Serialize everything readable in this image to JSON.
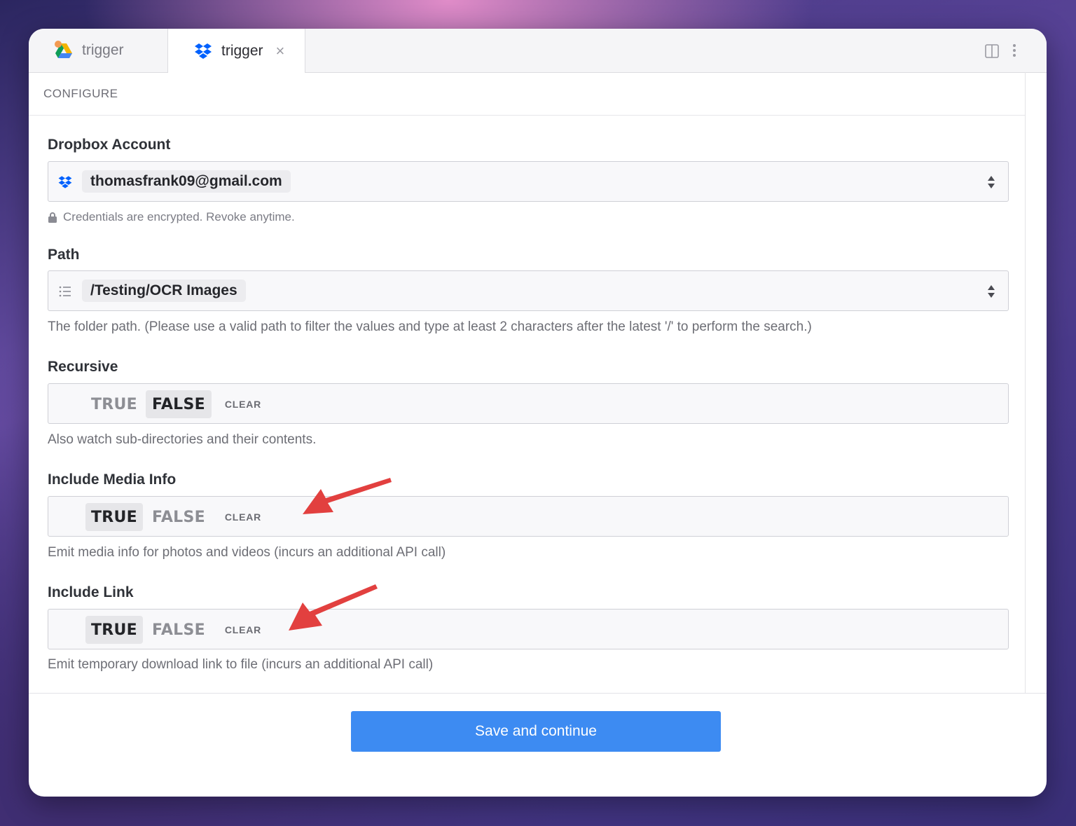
{
  "tabs": [
    {
      "label": "trigger",
      "icon": "google-drive-icon",
      "active": false
    },
    {
      "label": "trigger",
      "icon": "dropbox-icon",
      "active": true,
      "close_icon": "×"
    }
  ],
  "toolbar": {
    "split_icon": "split-view-icon",
    "more_icon": "more-vertical-icon"
  },
  "section": {
    "title": "CONFIGURE"
  },
  "fields": {
    "account": {
      "label": "Dropbox Account",
      "value": "thomasfrank09@gmail.com",
      "icon": "dropbox-icon",
      "note": "Credentials are encrypted. Revoke anytime."
    },
    "path": {
      "label": "Path",
      "value": "/Testing/OCR Images",
      "icon": "list-icon",
      "help": "The folder path. (Please use a valid path to filter the values and type at least 2 characters after the latest '/' to perform the search.)"
    },
    "recursive": {
      "label": "Recursive",
      "true_label": "TRUE",
      "false_label": "FALSE",
      "clear_label": "CLEAR",
      "selected": "FALSE",
      "help": "Also watch sub-directories and their contents."
    },
    "media_info": {
      "label": "Include Media Info",
      "true_label": "TRUE",
      "false_label": "FALSE",
      "clear_label": "CLEAR",
      "selected": "TRUE",
      "help": "Emit media info for photos and videos (incurs an additional API call)"
    },
    "include_link": {
      "label": "Include Link",
      "true_label": "TRUE",
      "false_label": "FALSE",
      "clear_label": "CLEAR",
      "selected": "TRUE",
      "help": "Emit temporary download link to file (incurs an additional API call)"
    }
  },
  "footer": {
    "save_label": "Save and continue"
  },
  "colors": {
    "accent": "#3d8bf2",
    "annotation_arrow": "#e2403f",
    "dropbox": "#0061fe"
  }
}
